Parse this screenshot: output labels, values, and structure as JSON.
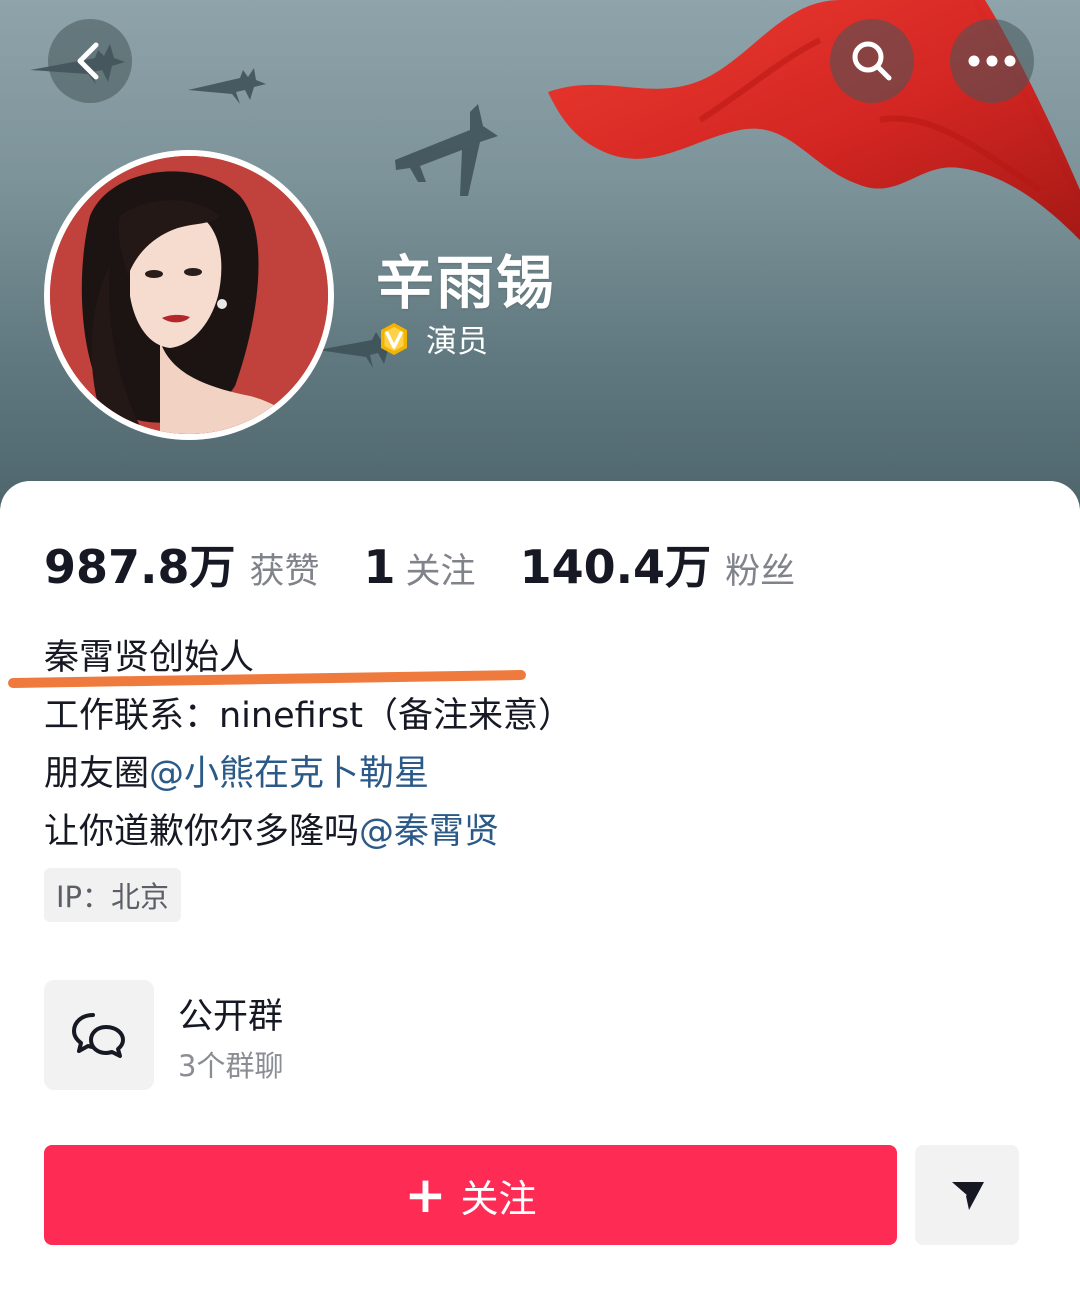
{
  "header": {
    "back_icon": "chevron-left-icon",
    "search_icon": "search-icon",
    "more_icon": "more-horizontal-icon"
  },
  "profile": {
    "nickname": "辛雨锡",
    "verified_label": "演员",
    "verified_badge_color": "#f2b400"
  },
  "stats": [
    {
      "value": "987.8万",
      "label": "获赞"
    },
    {
      "value": "1",
      "label": "关注"
    },
    {
      "value": "140.4万",
      "label": "粉丝"
    }
  ],
  "bio": {
    "line1": "秦霄贤创始人",
    "line2": "工作联系：ninefirst（备注来意）",
    "line3_prefix": "朋友圈",
    "line3_mention": "@小熊在克卜勒星",
    "line4_prefix": "让你道歉你尔多隆吗",
    "line4_mention": "@秦霄贤"
  },
  "ip_tag": "IP：北京",
  "group": {
    "title": "公开群",
    "subtitle": "3个群聊",
    "icon": "chat-bubbles-icon"
  },
  "actions": {
    "follow_plus": "+",
    "follow_label": "关注",
    "share_icon": "send-icon"
  },
  "colors": {
    "accent": "#fe2c55",
    "mention": "#2c5a88",
    "annotation_underline": "#ef7a3e",
    "banner": "#7c9399",
    "flag_red": "#d8201c"
  }
}
